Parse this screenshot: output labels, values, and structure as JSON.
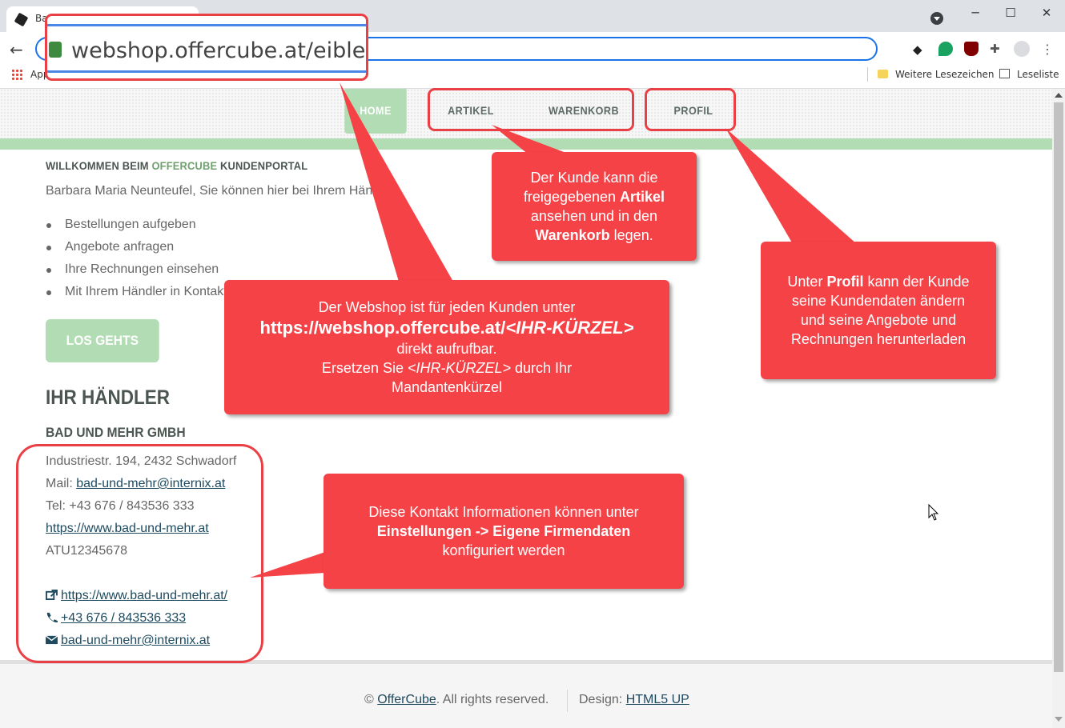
{
  "browser": {
    "tab_title": "Ba",
    "bookmarks_apps": "Apps",
    "bookmarks_more": "Weitere Lesezeichen",
    "reading_list": "Leseliste",
    "url": "webshop.offercube.at/eibler"
  },
  "nav": {
    "home": "HOME",
    "artikel": "ARTIKEL",
    "warenkorb": "WARENKORB",
    "profil": "PROFIL"
  },
  "main": {
    "welcome_prefix": "WILLKOMMEN BEIM ",
    "welcome_brand": "OFFERCUBE",
    "welcome_suffix": " KUNDENPORTAL",
    "intro": "Barbara Maria Neunteufel, Sie können hier bei Ihrem Händler:",
    "features": [
      "Bestellungen aufgeben",
      "Angebote anfragen",
      "Ihre Rechnungen einsehen",
      "Mit Ihrem Händler in Kontakt treten"
    ],
    "cta_label": "LOS GEHTS"
  },
  "dealer": {
    "heading": "IHR HÄNDLER",
    "name": "BAD UND MEHR GMBH",
    "address": "Industriestr. 194, 2432 Schwadorf",
    "mail_label": "Mail: ",
    "mail": "bad-und-mehr@internix.at",
    "tel": "Tel: +43 676 / 843536 333",
    "website": "https://www.bad-und-mehr.at",
    "uid": "ATU12345678",
    "link_website": "https://www.bad-und-mehr.at/",
    "link_phone": "+43 676 / 843536 333",
    "link_mail": "bad-und-mehr@internix.at"
  },
  "footer": {
    "copyright_prefix": "© ",
    "copyright_link": "OfferCube",
    "copyright_suffix": ". All rights reserved.",
    "design_prefix": "Design: ",
    "design_link": "HTML5 UP"
  },
  "annotations": {
    "artikel": {
      "line1": "Der Kunde kann die",
      "line2_pre": "freigegebenen ",
      "line2_bold": "Artikel",
      "line3": "ansehen und in den",
      "line4_bold": "Warenkorb",
      "line4_post": " legen."
    },
    "profil": {
      "line1_pre": "Unter ",
      "line1_bold": "Profil",
      "line1_post": " kann der Kunde",
      "line2": "seine Kundendaten ändern",
      "line3": "und seine Angebote und",
      "line4": "Rechnungen herunterladen"
    },
    "webshop": {
      "line1": "Der Webshop ist für jeden Kunden unter",
      "line2_bold": "https://webshop.offercube.at/",
      "line2_bold_italic": "<IHR-KÜRZEL>",
      "line3": "direkt aufrufbar.",
      "line4_pre": "Ersetzen Sie ",
      "line4_italic": "<IHR-KÜRZEL>",
      "line4_post": " durch Ihr",
      "line5": "Mandantenkürzel"
    },
    "kontakt": {
      "line1": "Diese Kontakt Informationen können unter",
      "line2_bold": "Einstellungen -> Eigene Firmendaten",
      "line3": "konfiguriert werden"
    }
  },
  "colors": {
    "accent_green": "#b2dcb3",
    "brand_green": "#6fa06e",
    "heading_dark": "#4b5651",
    "callout_red": "#f44246",
    "link_blue": "#1e4a5f"
  }
}
